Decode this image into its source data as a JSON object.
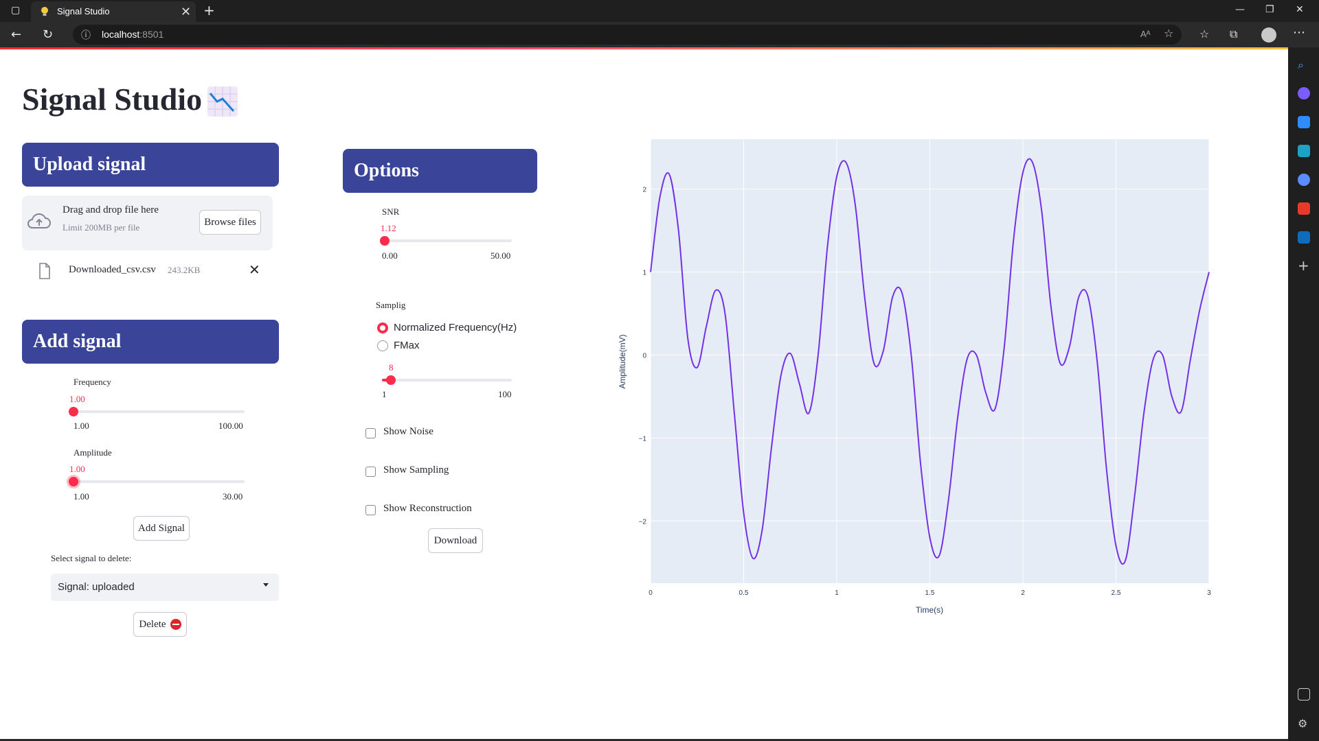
{
  "browser": {
    "tab_title": "Signal Studio",
    "tab_close": "✕",
    "new_tab": "+",
    "url_host": "localhost",
    "url_port": ":8501",
    "read_aloud": "Aᴬ"
  },
  "header": {
    "title": "Signal Studio",
    "emoji_icon": "chart-decreasing-icon"
  },
  "upload": {
    "header": "Upload signal",
    "drop_text": "Drag and drop file here",
    "limit_text": "Limit 200MB per file",
    "browse_label": "Browse files",
    "file_name": "Downloaded_csv.csv",
    "file_size": "243.2KB",
    "remove_symbol": "✕"
  },
  "add_signal": {
    "header": "Add signal",
    "frequency": {
      "label": "Frequency",
      "value": "1.00",
      "min": "1.00",
      "max": "100.00",
      "position": 0.0
    },
    "amplitude": {
      "label": "Amplitude",
      "value": "1.00",
      "min": "1.00",
      "max": "30.00",
      "position": 0.0
    },
    "add_button": "Add Signal",
    "select_label": "Select signal to delete:",
    "selected_signal": "Signal: uploaded",
    "delete_button": "Delete"
  },
  "options": {
    "header": "Options",
    "snr": {
      "label": "SNR",
      "value": "1.12",
      "min": "0.00",
      "max": "50.00",
      "position": 0.0224
    },
    "sampling_label": "Samplig",
    "sampling_options": [
      "Normalized Frequency(Hz)",
      "FMax"
    ],
    "sampling_selected": "Normalized Frequency(Hz)",
    "sampling_slider": {
      "value": "8",
      "min": "1",
      "max": "100",
      "position": 0.0707
    },
    "show_noise": "Show Noise",
    "show_sampling": "Show Sampling",
    "show_reconstruction": "Show Reconstruction",
    "download_button": "Download"
  },
  "chart_data": {
    "type": "line",
    "title": "",
    "xlabel": "Time(s)",
    "ylabel": "Amplitude(mV)",
    "xlim": [
      0,
      3
    ],
    "ylim": [
      -2.75,
      2.6
    ],
    "x_ticks": [
      0,
      0.5,
      1,
      1.5,
      2,
      2.5,
      3
    ],
    "x_tick_labels": [
      "0",
      "0.5",
      "1",
      "1.5",
      "2",
      "2.5",
      "3"
    ],
    "y_ticks": [
      2,
      1,
      0,
      -1,
      -2
    ],
    "y_tick_labels": [
      "2",
      "1",
      "0",
      "−1",
      "−2"
    ],
    "grid": true,
    "background": "#e5ecf6",
    "line_color": "#7430e6",
    "series": [
      {
        "x": [
          0,
          0.05,
          0.1,
          0.15,
          0.2,
          0.25,
          0.3,
          0.35,
          0.4,
          0.45,
          0.5,
          0.55,
          0.6,
          0.65,
          0.7,
          0.75,
          0.8,
          0.85,
          0.9,
          0.95,
          1.0,
          1.05,
          1.1,
          1.15,
          1.2,
          1.25,
          1.3,
          1.35,
          1.4,
          1.45,
          1.5,
          1.55,
          1.6,
          1.65,
          1.7,
          1.75,
          1.8,
          1.85,
          1.9,
          1.95,
          2.0,
          2.05,
          2.1,
          2.15,
          2.2,
          2.25,
          2.3,
          2.35,
          2.4,
          2.45,
          2.5,
          2.55,
          2.6,
          2.65,
          2.7,
          2.75,
          2.8,
          2.85,
          2.9,
          2.95,
          3.0
        ],
        "y": [
          1.0,
          1.9,
          2.18,
          1.5,
          0.2,
          -0.15,
          0.35,
          0.78,
          0.5,
          -0.7,
          -1.9,
          -2.45,
          -2.1,
          -1.1,
          -0.25,
          0.02,
          -0.35,
          -0.7,
          0.0,
          1.3,
          2.15,
          2.32,
          1.8,
          0.7,
          -0.1,
          0.05,
          0.7,
          0.75,
          0.0,
          -1.3,
          -2.2,
          -2.42,
          -1.75,
          -0.75,
          -0.05,
          0.0,
          -0.45,
          -0.65,
          0.1,
          1.4,
          2.2,
          2.33,
          1.75,
          0.6,
          -0.1,
          0.1,
          0.7,
          0.7,
          -0.1,
          -1.4,
          -2.3,
          -2.48,
          -1.7,
          -0.7,
          -0.05,
          0.0,
          -0.5,
          -0.68,
          -0.05,
          0.55,
          1.0
        ]
      }
    ]
  }
}
